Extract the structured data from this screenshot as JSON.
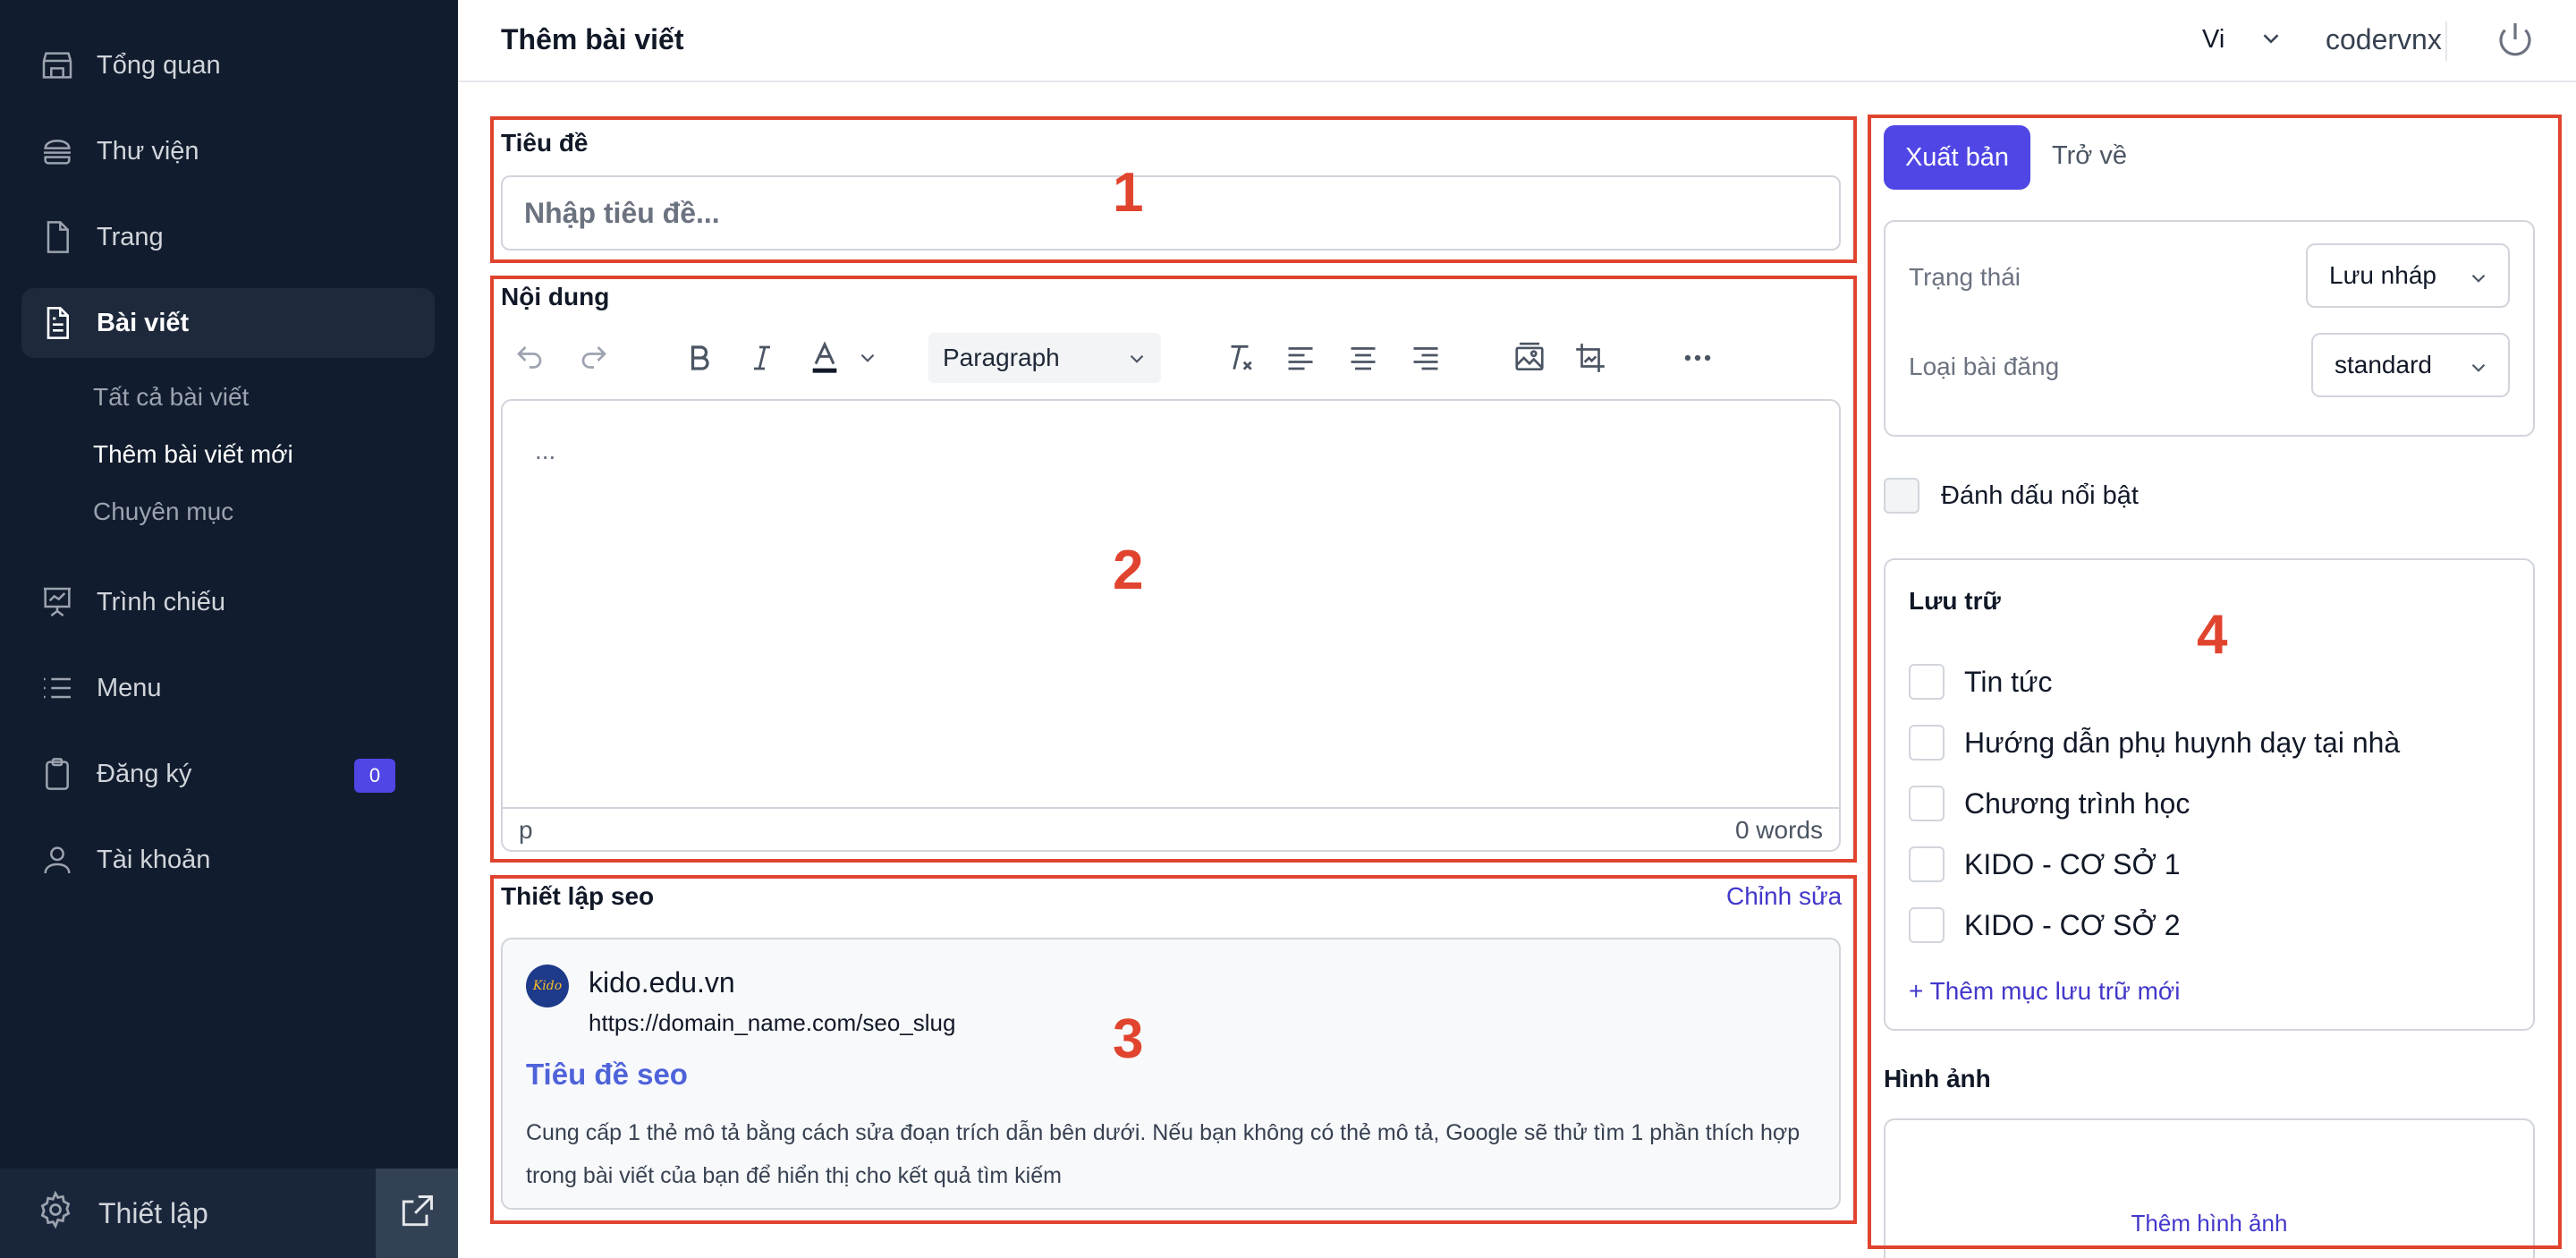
{
  "sidebar": {
    "items": [
      {
        "label": "Tổng quan",
        "icon": "store-icon"
      },
      {
        "label": "Thư viện",
        "icon": "burger-stack-icon"
      },
      {
        "label": "Trang",
        "icon": "file-icon"
      },
      {
        "label": "Bài viết",
        "icon": "file-text-icon"
      },
      {
        "label": "Trình chiếu",
        "icon": "presentation-icon"
      },
      {
        "label": "Menu",
        "icon": "list-icon"
      },
      {
        "label": "Đăng ký",
        "icon": "clipboard-icon",
        "badge": "0"
      },
      {
        "label": "Tài khoản",
        "icon": "user-icon"
      }
    ],
    "sub_items": [
      "Tất cả bài viết",
      "Thêm bài viết mới",
      "Chuyên mục"
    ],
    "settings_label": "Thiết lập"
  },
  "header": {
    "title": "Thêm bài viết",
    "language": "Vi",
    "username": "codervnx"
  },
  "form": {
    "title_label": "Tiêu đề",
    "title_placeholder": "Nhập tiêu đề...",
    "content_label": "Nội dung",
    "block_format": "Paragraph",
    "editor_placeholder": "...",
    "status_tag": "p",
    "word_count": "0 words"
  },
  "seo": {
    "label": "Thiết lập seo",
    "edit_label": "Chỉnh sửa",
    "logo_text": "Kido",
    "domain": "kido.edu.vn",
    "url": "https://domain_name.com/seo_slug",
    "title": "Tiêu đề seo",
    "description": "Cung cấp 1 thẻ mô tả bằng cách sửa đoạn trích dẫn bên dưới. Nếu bạn không có thẻ mô tả, Google sẽ thử tìm 1 phần thích hợp trong bài viết của bạn để hiển thị cho kết quả tìm kiếm"
  },
  "publish": {
    "publish_label": "Xuất bản",
    "back_label": "Trở về",
    "status_label": "Trạng thái",
    "status_value": "Lưu nháp",
    "post_type_label": "Loại bài đăng",
    "post_type_value": "standard",
    "featured_label": "Đánh dấu nổi bật",
    "storage_title": "Lưu trữ",
    "categories": [
      "Tin tức",
      "Hướng dẫn phụ huynh dạy tại nhà",
      "Chương trình học",
      "KIDO - CƠ SỞ 1",
      "KIDO - CƠ SỞ 2"
    ],
    "add_category_label": "+ Thêm mục lưu trữ mới",
    "image_title": "Hình ảnh",
    "add_image_label": "Thêm hình ảnh"
  },
  "annotations": [
    "1",
    "2",
    "3",
    "4"
  ],
  "colors": {
    "sidebar_bg": "#111c2e",
    "accent": "#4f46e5",
    "annotation": "#e0442f",
    "seo_title": "#4f63d9"
  }
}
